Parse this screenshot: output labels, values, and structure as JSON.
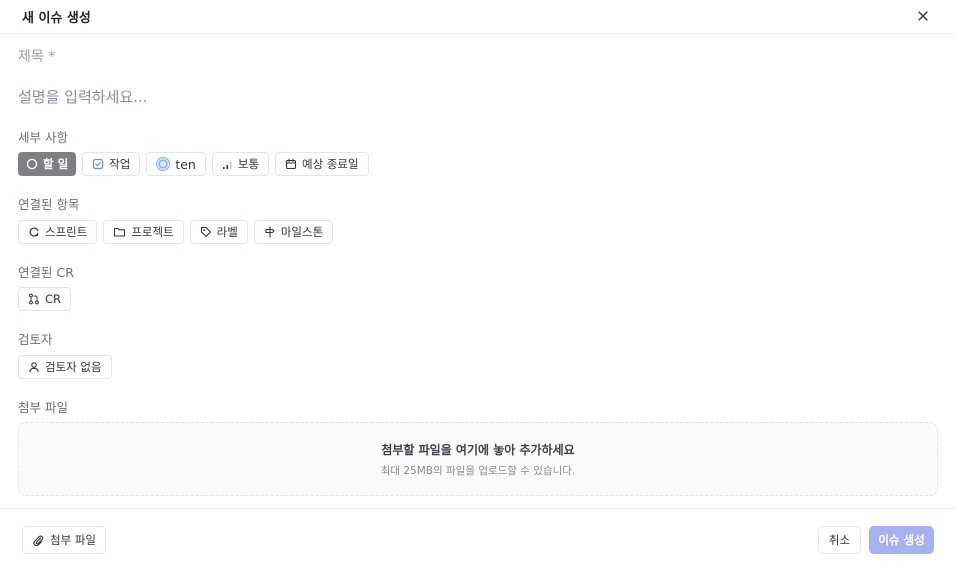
{
  "dialog": {
    "title": "새 이슈 생성"
  },
  "form": {
    "title_placeholder": "제목 *",
    "description_placeholder": "설명을 입력하세요..."
  },
  "details": {
    "label": "세부 사항",
    "status": "할 일",
    "type": "작업",
    "assignee": "ten",
    "priority": "보통",
    "due_date": "예상 종료일"
  },
  "linked_items": {
    "label": "연결된 항목",
    "sprint": "스프린트",
    "project": "프로젝트",
    "label_chip": "라벨",
    "milestone": "마일스톤"
  },
  "linked_cr": {
    "label": "연결된 CR",
    "cr": "CR"
  },
  "reviewer": {
    "label": "검토자",
    "none": "검토자 없음"
  },
  "attachments": {
    "label": "첨부 파일",
    "drop_title": "첨부할 파일을 여기에 놓아 추가하세요",
    "drop_subtitle": "최대 25MB의 파일을 업로드할 수 있습니다."
  },
  "footer": {
    "attach_button": "첨부 파일",
    "cancel_button": "취소",
    "create_button": "이슈 생성"
  },
  "colors": {
    "primary_disabled": "#a6b1ee",
    "status_bg": "#7d7f83"
  }
}
